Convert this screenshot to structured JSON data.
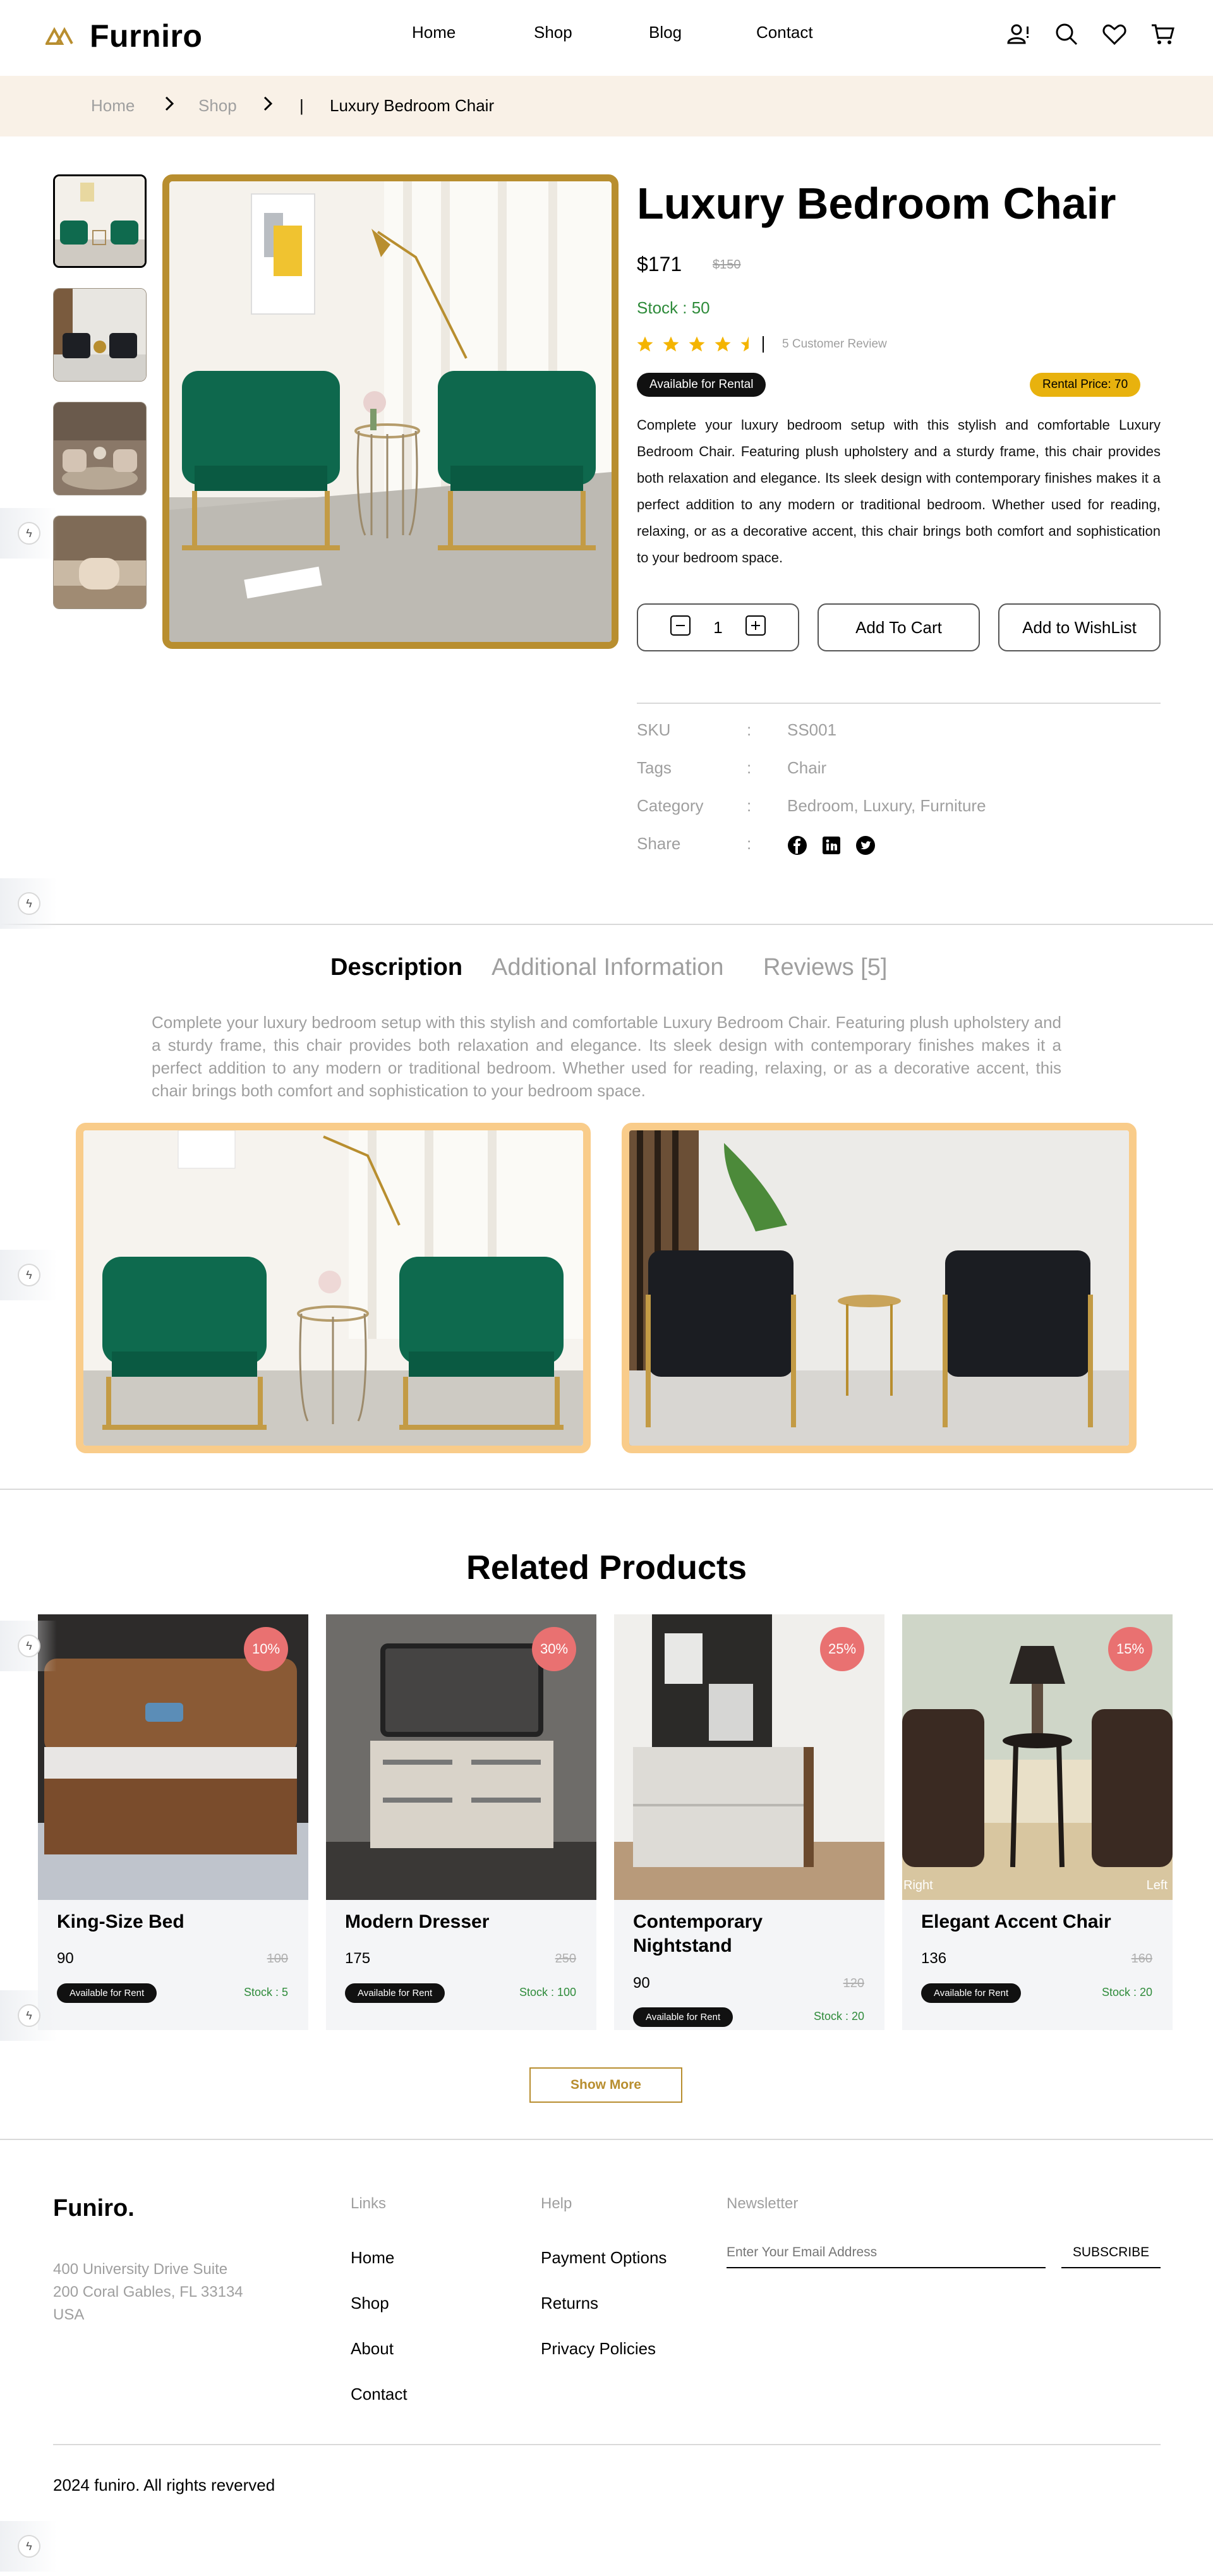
{
  "header": {
    "brand": "Furniro",
    "nav": [
      "Home",
      "Shop",
      "Blog",
      "Contact"
    ],
    "icons": [
      "account-alert-icon",
      "search-icon",
      "heart-icon",
      "cart-icon"
    ]
  },
  "breadcrumb": {
    "items": [
      "Home",
      "Shop"
    ],
    "separator": "|",
    "current": "Luxury Bedroom Chair"
  },
  "product": {
    "title": "Luxury Bedroom Chair",
    "price": "$171",
    "old_price": "$150",
    "stock": "Stock : 50",
    "rating": 4.5,
    "reviews": "5 Customer Review",
    "rental_badge": "Available for Rental",
    "rental_price": "Rental Price: 70",
    "description": "Complete your luxury bedroom setup with this stylish and comfortable Luxury Bedroom Chair. Featuring plush upholstery and a sturdy frame, this chair provides both relaxation and elegance. Its sleek design with contemporary finishes makes it a perfect addition to any modern or traditional bedroom. Whether used for reading, relaxing, or as a decorative accent, this chair brings both comfort and sophistication to your bedroom space.",
    "quantity": "1",
    "add_to_cart": "Add To Cart",
    "add_to_wishlist": "Add to WishList",
    "meta": {
      "sku_label": "SKU",
      "sku": "SS001",
      "tags_label": "Tags",
      "tags": "Chair",
      "category_label": "Category",
      "category": "Bedroom,  Luxury,  Furniture",
      "share_label": "Share",
      "colon": ":"
    },
    "share_icons": [
      "facebook-icon",
      "linkedin-icon",
      "twitter-icon"
    ]
  },
  "tabs": {
    "items": [
      "Description",
      "Additional Information",
      "Reviews [5]"
    ],
    "active": 0,
    "content": "Complete your luxury bedroom setup with this stylish and comfortable Luxury Bedroom Chair. Featuring plush upholstery and a sturdy frame, this chair provides both relaxation and elegance. Its sleek design with contemporary finishes makes it a perfect addition to any modern or traditional bedroom. Whether used for reading, relaxing, or as a decorative accent, this chair brings both comfort and sophistication to your bedroom space."
  },
  "related": {
    "title": "Related Products",
    "items": [
      {
        "name": "King-Size Bed",
        "price": "90",
        "old": "100",
        "discount": "10%",
        "rent": "Available for Rent",
        "stock": "Stock : 5"
      },
      {
        "name": "Modern Dresser",
        "price": "175",
        "old": "250",
        "discount": "30%",
        "rent": "Available for Rent",
        "stock": "Stock : 100"
      },
      {
        "name": "Contemporary Nightstand",
        "price": "90",
        "old": "120",
        "discount": "25%",
        "rent": "Available for Rent",
        "stock": "Stock : 20"
      },
      {
        "name": "Elegant Accent Chair",
        "price": "136",
        "old": "160",
        "discount": "15%",
        "rent": "Available for Rent",
        "stock": "Stock : 20",
        "img_left": "Right",
        "img_right": "Left"
      }
    ],
    "show_more": "Show More"
  },
  "footer": {
    "brand": "Funiro.",
    "address": [
      "400 University Drive Suite",
      "200 Coral Gables, FL 33134",
      "USA"
    ],
    "links_label": "Links",
    "links": [
      "Home",
      "Shop",
      "About",
      "Contact"
    ],
    "help_label": "Help",
    "help": [
      "Payment Options",
      "Returns",
      "Privacy Policies"
    ],
    "newsletter_label": "Newsletter",
    "email_placeholder": "Enter Your Email Address",
    "subscribe": "SUBSCRIBE",
    "copyright": "2024 funiro. All rights reverved"
  },
  "colors": {
    "accent": "#B88E2F",
    "cream": "#F9F1E7",
    "discount": "#E97171",
    "stock_green": "#2E8B3A",
    "rental_yellow": "#E8B20E"
  }
}
